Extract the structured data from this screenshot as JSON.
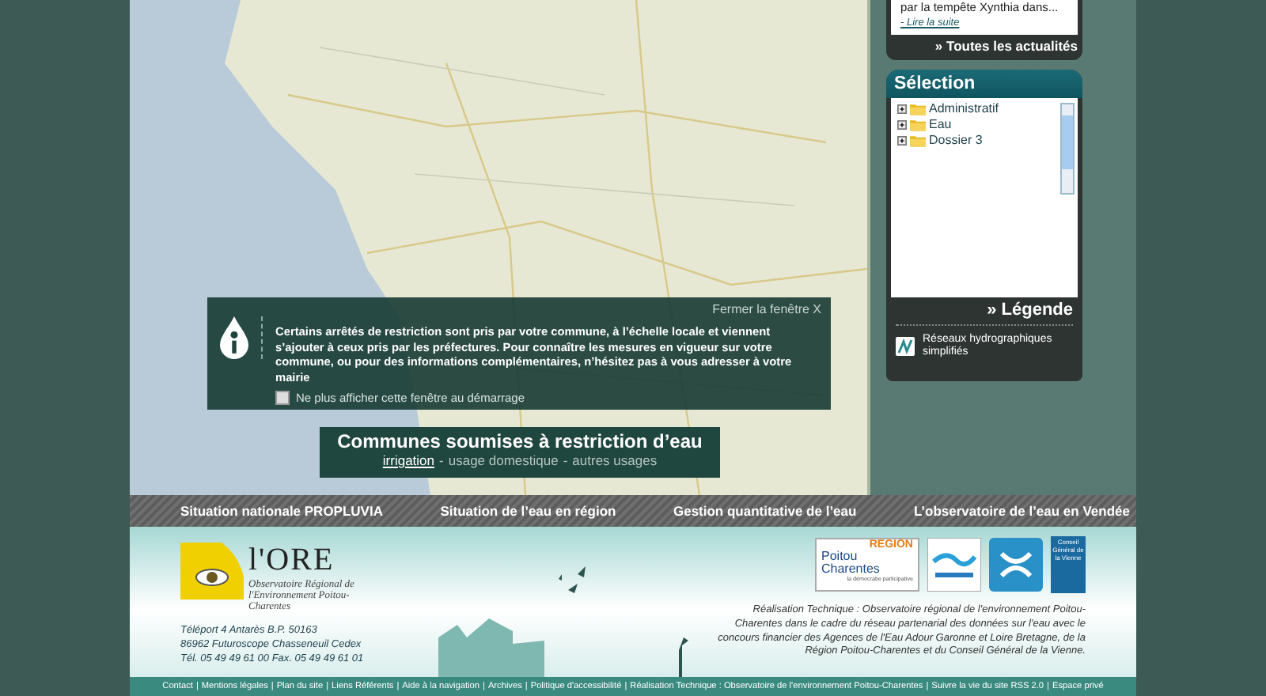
{
  "news_card": {
    "excerpt": "par la tempête Xynthia dans...",
    "read_more": "- Lire la suite",
    "all_news": "» Toutes les actualités"
  },
  "selection": {
    "title": "Sélection",
    "items": [
      {
        "label": "Administratif",
        "expanded": false
      },
      {
        "label": "Eau",
        "expanded": false
      },
      {
        "label": "Dossier 3",
        "expanded": false
      }
    ]
  },
  "legend": {
    "title": "» Légende",
    "items": [
      {
        "label": "Réseaux hydrographiques simplifiés"
      }
    ]
  },
  "popup": {
    "close_label": "Fermer la fenêtre",
    "close_glyph": "X",
    "message": "Certains arrêtés de restriction sont pris par votre commune, à l’échelle locale et viennent s’ajouter à ceux pris par les préfectures. Pour connaître les mesures en vigueur sur votre commune, ou pour des informations complémentaires, n’hésitez pas à vous adresser à votre mairie",
    "checkbox_label": "Ne plus afficher cette fenêtre au démarrage",
    "checked": false
  },
  "map_title": {
    "title": "Communes soumises à restriction d’eau",
    "separator": "-",
    "filters": [
      {
        "label": "irrigation",
        "selected": true
      },
      {
        "label": "usage domestique",
        "selected": false
      },
      {
        "label": "autres usages",
        "selected": false
      }
    ]
  },
  "nav": [
    "Situation nationale PROPLUVIA",
    "Situation de l’eau en région",
    "Gestion quantitative de l’eau",
    "L’observatoire de l’eau en Vendée"
  ],
  "footer": {
    "logo_title": "l'ORE",
    "logo_subtitle": "Observatoire Régional de l'Environnement Poitou-Charentes",
    "address": [
      "Téléport 4 Antarès B.P. 50163",
      "86962 Futuroscope Chasseneuil Cedex",
      "Tél. 05 49 49 61 00 Fax. 05 49 49 61 01"
    ],
    "region_logo": {
      "top": "REGION",
      "name": "Poitou Charentes",
      "tagline": "la démocratie participative"
    },
    "cg_logo": "Conseil Général de la Vienne",
    "credits": "Réalisation Technique : Observatoire régional de l'environnement Poitou-Charentes dans le cadre du réseau partenarial des données sur l'eau avec le concours financier des Agences de l'Eau Adour Garonne et Loire Bretagne, de la Région Poitou-Charentes et du Conseil Général de la Vienne."
  },
  "footer_links": {
    "separator": "|",
    "links": [
      "Contact",
      "Mentions légales",
      "Plan du site",
      "Liens Référents",
      "Aide à la navigation",
      "Archives",
      "Politique d'accessibilité",
      "Réalisation Technique : Observatoire de l'environnement Poitou-Charentes",
      "Suivre la vie du site RSS 2.0",
      "Espace privé"
    ]
  }
}
